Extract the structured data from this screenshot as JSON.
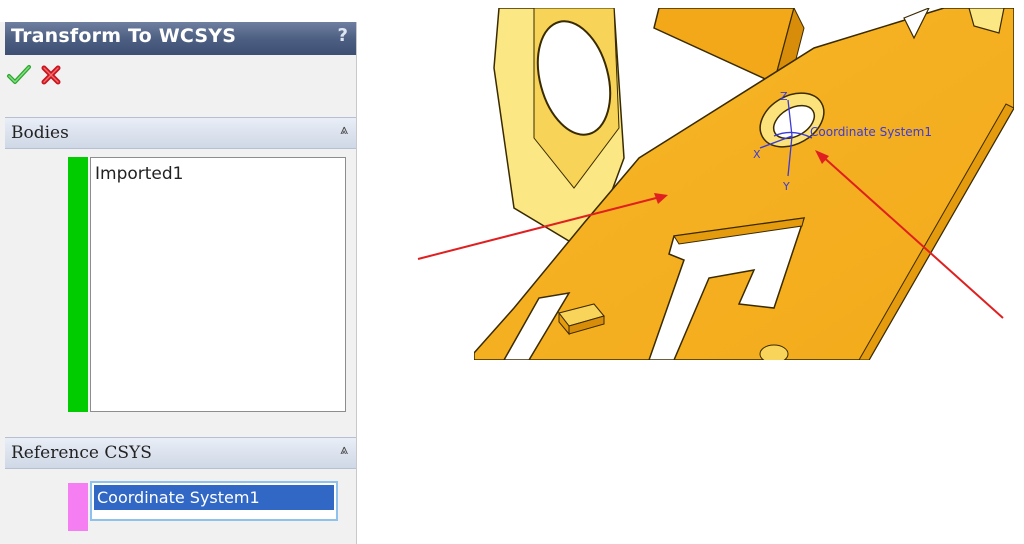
{
  "property_manager": {
    "title": "Transform To WCSYS",
    "help_label": "?",
    "ok_icon": "checkmark-icon",
    "cancel_icon": "x-icon",
    "sections": {
      "bodies": {
        "label": "Bodies",
        "items": [
          "Imported1"
        ],
        "color": "#00cc00"
      },
      "reference_csys": {
        "label": "Reference CSYS",
        "selected": "Coordinate System1",
        "color": "#f57ef2"
      }
    }
  },
  "viewport": {
    "csys_label": "Coordinate System1",
    "axis_labels": {
      "z": "Z",
      "x": "X",
      "y": "Y"
    },
    "part_color": "#f5b420",
    "arrow_color": "#e02020"
  }
}
